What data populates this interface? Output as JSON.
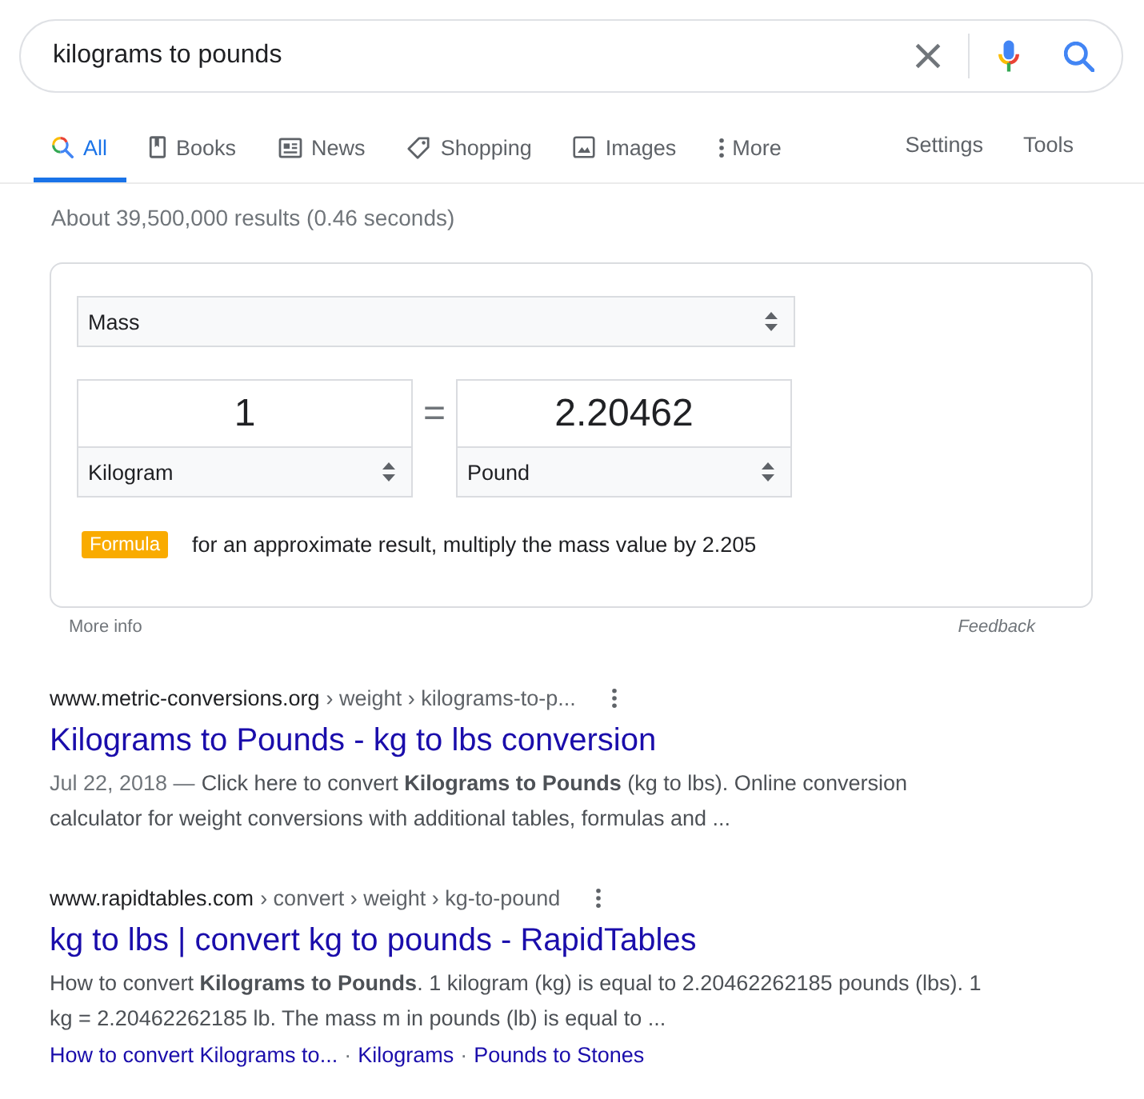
{
  "search": {
    "value": "kilograms to pounds"
  },
  "tabs": [
    {
      "label": "All",
      "kind": "all",
      "selected": true
    },
    {
      "label": "Books",
      "kind": "books",
      "selected": false
    },
    {
      "label": "News",
      "kind": "news",
      "selected": false
    },
    {
      "label": "Shopping",
      "kind": "shopping",
      "selected": false
    },
    {
      "label": "Images",
      "kind": "images",
      "selected": false
    },
    {
      "label": "More",
      "kind": "more",
      "selected": false
    }
  ],
  "tool_links": [
    "Settings",
    "Tools"
  ],
  "result_stats": "About 39,500,000 results (0.46 seconds)",
  "converter": {
    "category": "Mass",
    "from": {
      "value": "1",
      "unit": "Kilogram"
    },
    "equals": "=",
    "to": {
      "value": "2.20462",
      "unit": "Pound"
    },
    "formula": {
      "badge": "Formula",
      "text": "for an approximate result, multiply the mass value by 2.205"
    }
  },
  "card_footer": {
    "more_info": "More info",
    "feedback": "Feedback"
  },
  "results": [
    {
      "site": "www.metric-conversions.org",
      "path": "› weight › kilograms-to-p...",
      "title": "Kilograms to Pounds - kg to lbs conversion",
      "date": "Jul 22, 2018 —",
      "snippet": "Click here to convert **Kilograms to Pounds** (kg to lbs). Online conversion calculator for weight conversions with additional tables, formulas and ..."
    },
    {
      "site": "www.rapidtables.com",
      "path": "› convert › weight › kg-to-pound",
      "title": "kg to lbs | convert kg to pounds - RapidTables",
      "snippet": "How to convert **Kilograms to Pounds**. 1 kilogram (kg) is equal to 2.20462262185 pounds (lbs). 1 kg = 2.20462262185 lb. The mass m in pounds (lb) is equal to ...",
      "sitelinks": [
        "How to convert Kilograms to...",
        "Kilograms",
        "Pounds to Stones"
      ],
      "sitelink_separator": "·"
    }
  ]
}
